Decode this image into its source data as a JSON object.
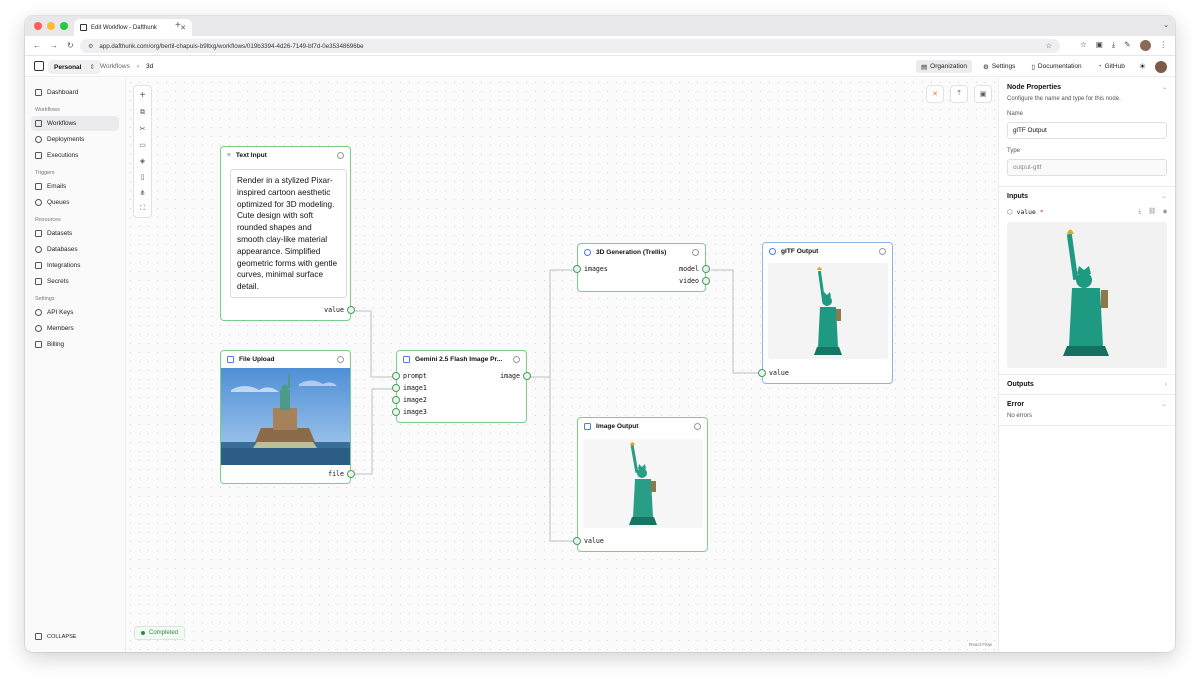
{
  "browser": {
    "tab_title": "Edit Workflow - Dafthunk",
    "url": "app.dafthunk.com/org/bertil-chapuis-b9ltxg/workflows/019b3394-4d26-7149-bf7d-0e35348696be"
  },
  "header": {
    "org": "Personal",
    "breadcrumb_parent": "Workflows",
    "breadcrumb_current": "3d",
    "buttons": [
      "Organization",
      "Settings",
      "Documentation",
      "GitHub"
    ]
  },
  "sidebar": {
    "dashboard": "Dashboard",
    "sections": {
      "workflows": "Workflows",
      "triggers": "Triggers",
      "resources": "Resources",
      "settings": "Settings"
    },
    "workflows_items": [
      "Workflows",
      "Deployments",
      "Executions"
    ],
    "triggers_items": [
      "Emails",
      "Queues"
    ],
    "resources_items": [
      "Datasets",
      "Databases",
      "Integrations",
      "Secrets"
    ],
    "settings_items": [
      "API Keys",
      "Members",
      "Billing"
    ],
    "collapse": "COLLAPSE"
  },
  "canvas": {
    "status": "Completed",
    "attribution": "React Flow"
  },
  "nodes": {
    "text_input": {
      "title": "Text Input",
      "text": "Render in a stylized Pixar-inspired cartoon aesthetic optimized for 3D modeling. Cute design with soft rounded shapes and smooth clay-like material appearance. Simplified geometric forms with gentle curves, minimal surface detail.",
      "output": "value"
    },
    "file_upload": {
      "title": "File Upload",
      "output": "file"
    },
    "gemini": {
      "title": "Gemini 2.5 Flash Image Pr...",
      "inputs": [
        "prompt",
        "image1",
        "image2",
        "image3"
      ],
      "output": "image"
    },
    "trellis": {
      "title": "3D Generation (Trellis)",
      "input": "images",
      "outputs": [
        "model",
        "video"
      ]
    },
    "gltf_output": {
      "title": "glTF Output",
      "input": "value"
    },
    "image_output": {
      "title": "Image Output",
      "input": "value"
    }
  },
  "panel": {
    "title": "Node Properties",
    "subtitle": "Configure the name and type for this node.",
    "name_label": "Name",
    "name_value": "glTF Output",
    "type_label": "Type",
    "type_value": "output-gltf",
    "inputs_title": "Inputs",
    "input_name": "value",
    "required_mark": "*",
    "outputs_title": "Outputs",
    "error_title": "Error",
    "error_text": "No errors"
  },
  "colors": {
    "node_border_green": "#7ccf8a",
    "node_border_selected": "#8fb3e6",
    "status_green": "#2f8a44",
    "statue": "#1f9a82"
  }
}
